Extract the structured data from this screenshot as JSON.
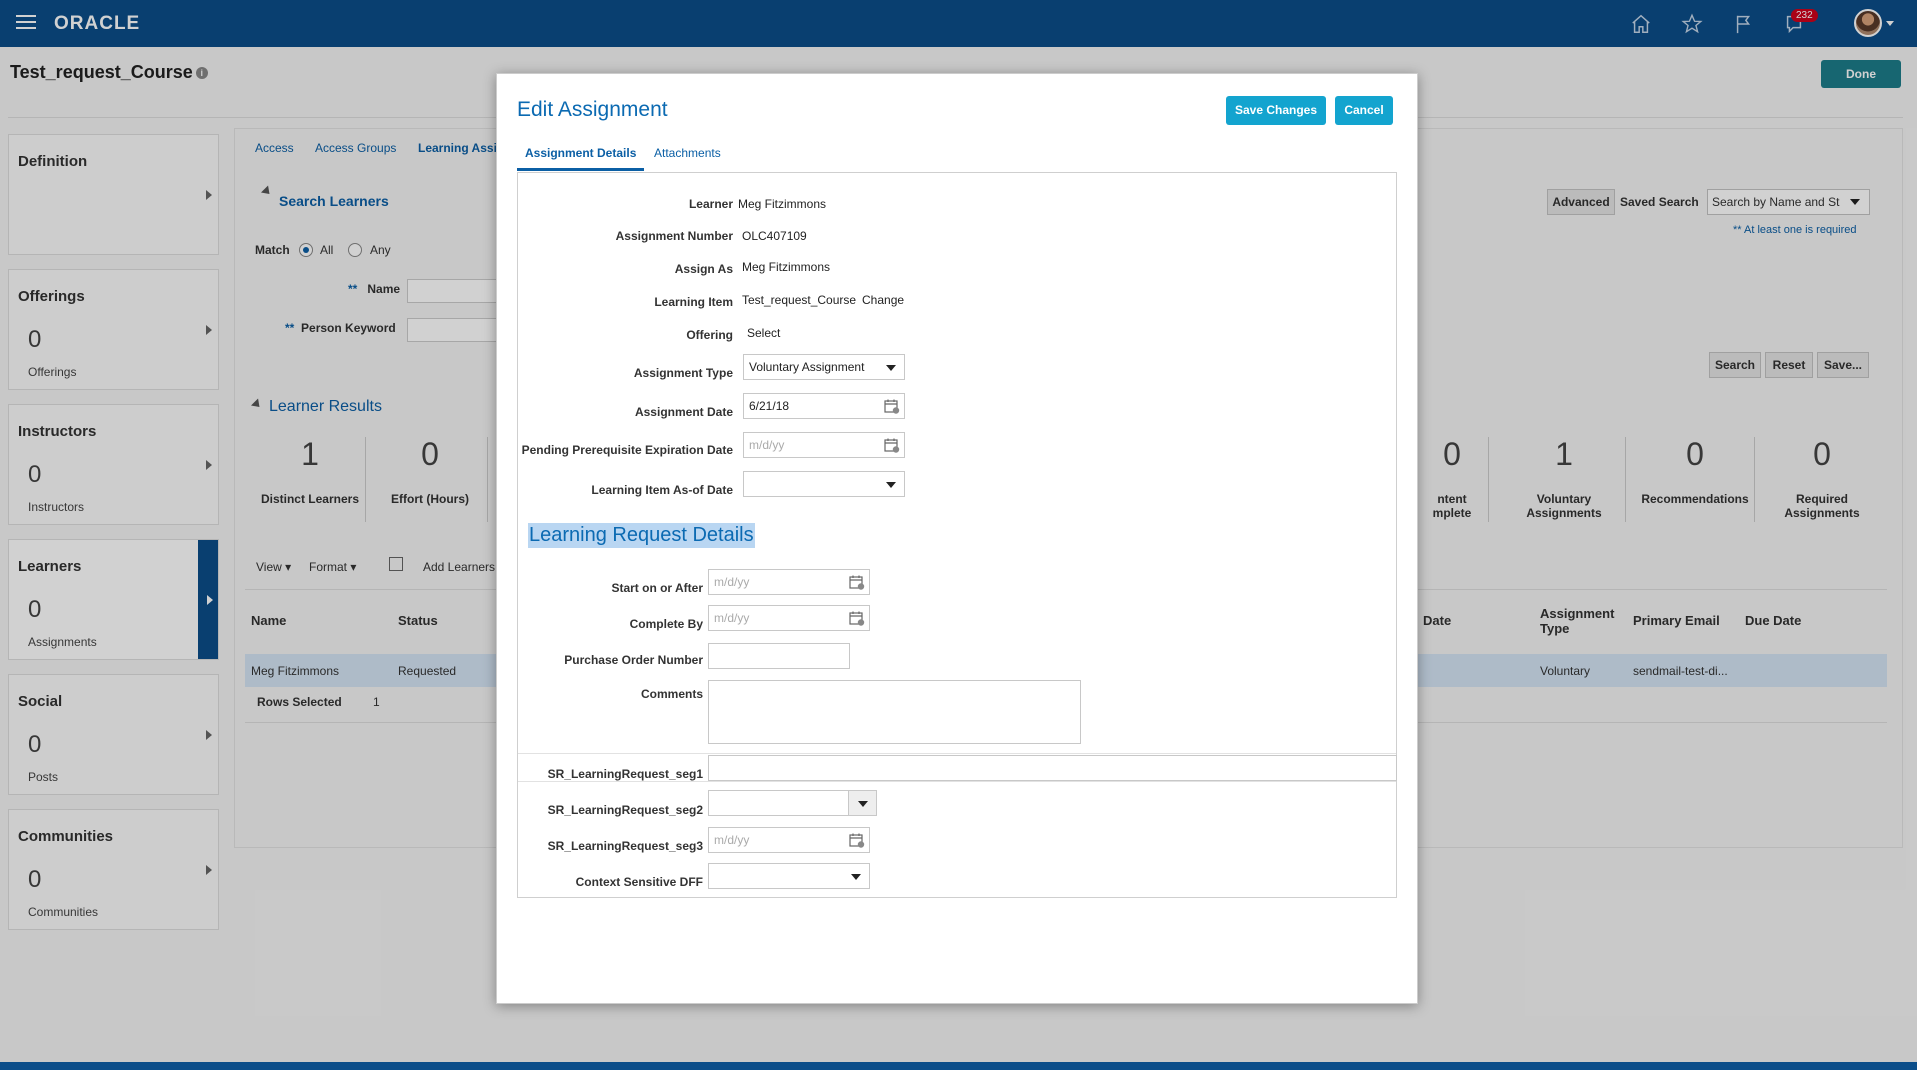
{
  "header": {
    "logo": "ORACLE",
    "notification_count": "232",
    "icons": [
      "home-icon",
      "star-icon",
      "flag-icon",
      "notifications-icon",
      "avatar"
    ]
  },
  "page": {
    "title": "Test_request_Course",
    "done_label": "Done"
  },
  "sidebar": {
    "cards": [
      {
        "title": "Definition",
        "count": "",
        "sub": ""
      },
      {
        "title": "Offerings",
        "count": "0",
        "sub": "Offerings"
      },
      {
        "title": "Instructors",
        "count": "0",
        "sub": "Instructors"
      },
      {
        "title": "Learners",
        "count": "0",
        "sub": "Assignments"
      },
      {
        "title": "Social",
        "count": "0",
        "sub": "Posts"
      },
      {
        "title": "Communities",
        "count": "0",
        "sub": "Communities"
      }
    ]
  },
  "main": {
    "tabs": [
      "Access",
      "Access Groups",
      "Learning Assi"
    ],
    "search_heading": "Search Learners",
    "match_label": "Match",
    "match_all": "All",
    "match_any": "Any",
    "name_label": "Name",
    "keyword_label": "Person Keyword",
    "required_marker": "**",
    "advanced_label": "Advanced",
    "saved_search_label": "Saved Search",
    "saved_search_value": "Search by Name and St",
    "required_note": "** At least one is required",
    "search_btn": "Search",
    "reset_btn": "Reset",
    "save_btn": "Save...",
    "results_heading": "Learner Results",
    "stats_left": [
      {
        "value": "1",
        "label": "Distinct Learners"
      },
      {
        "value": "0",
        "label": "Effort (Hours)"
      }
    ],
    "stats_right": [
      {
        "value": "0",
        "label_line1": "ntent",
        "label_line2": "mplete"
      },
      {
        "value": "1",
        "label_line1": "Voluntary",
        "label_line2": "Assignments"
      },
      {
        "value": "0",
        "label_line1": "Recommendations",
        "label_line2": ""
      },
      {
        "value": "0",
        "label_line1": "Required",
        "label_line2": "Assignments"
      }
    ],
    "toolbar": {
      "view": "View",
      "format": "Format",
      "add_learners": "Add Learners"
    },
    "columns_left": [
      "Name",
      "Status"
    ],
    "columns_right": [
      "Date",
      "Assignment Type",
      "Primary Email",
      "Due Date"
    ],
    "row": {
      "name": "Meg Fitzimmons",
      "status": "Requested",
      "type": "Voluntary",
      "email": "sendmail-test-di..."
    },
    "rows_selected_label": "Rows Selected",
    "rows_selected_value": "1"
  },
  "modal": {
    "title": "Edit Assignment",
    "save_label": "Save Changes",
    "cancel_label": "Cancel",
    "tabs": [
      "Assignment Details",
      "Attachments"
    ],
    "fields": {
      "learner_label": "Learner",
      "learner_value": "Meg Fitzimmons",
      "assignment_number_label": "Assignment Number",
      "assignment_number_value": "OLC407109",
      "assign_as_label": "Assign As",
      "assign_as_value": "Meg Fitzimmons",
      "learning_item_label": "Learning Item",
      "learning_item_value": "Test_request_Course",
      "change_link": "Change",
      "offering_label": "Offering",
      "offering_link": "Select",
      "assignment_type_label": "Assignment Type",
      "assignment_type_value": "Voluntary Assignment",
      "assignment_date_label": "Assignment Date",
      "assignment_date_value": "6/21/18",
      "pending_label": "Pending Prerequisite Expiration Date",
      "date_placeholder": "m/d/yy",
      "asof_label": "Learning Item As-of Date"
    },
    "request_section": {
      "heading": "Learning Request Details",
      "start_label": "Start on or After",
      "complete_label": "Complete By",
      "po_label": "Purchase Order Number",
      "comments_label": "Comments",
      "seg1_label": "SR_LearningRequest_seg1",
      "seg2_label": "SR_LearningRequest_seg2",
      "seg3_label": "SR_LearningRequest_seg3",
      "dff_label": "Context Sensitive DFF"
    }
  }
}
